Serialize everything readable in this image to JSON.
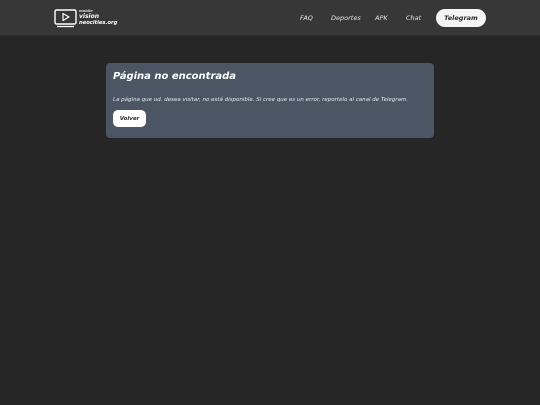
{
  "header": {
    "logo": {
      "line1": "mobile",
      "line2": "vision",
      "line3": "neocities.org"
    },
    "nav": [
      {
        "label": "FAQ"
      },
      {
        "label": "Deportes"
      },
      {
        "label": "APK"
      },
      {
        "label": "Chat"
      }
    ],
    "telegram_label": "Telegram"
  },
  "card": {
    "title": "Página no encontrada",
    "message": "La página que ud. desea visitar, no está disponible. Si cree que es un error, reportelo al canal de Telegram.",
    "back_label": "Volver"
  },
  "colors": {
    "background": "#262626",
    "header": "#373737",
    "card": "#4b5563",
    "button": "#f4f4f4"
  }
}
